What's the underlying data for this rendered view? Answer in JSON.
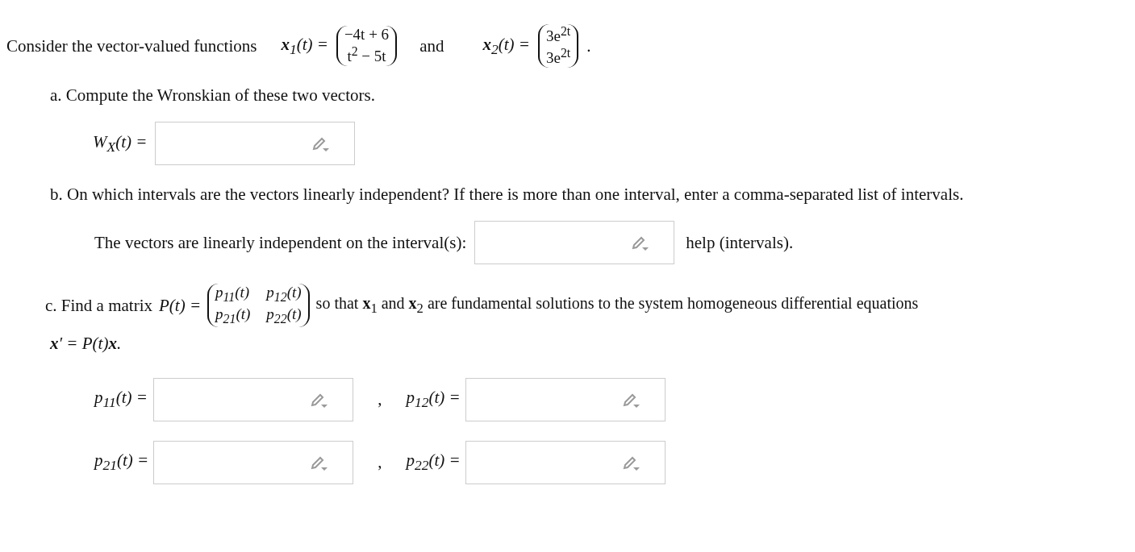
{
  "intro": {
    "text": "Consider the vector-valued functions",
    "connector": "and",
    "end": ".",
    "vectors": [
      {
        "label": "**x**$_{1}$(t) =",
        "entries": [
          "−4t + 6",
          "t$^{2}$ − 5t"
        ]
      },
      {
        "label": "**x**$_{2}$(t) =",
        "entries": [
          "3e$^{2t}$",
          "3e$^{2t}$"
        ]
      }
    ]
  },
  "part_a": {
    "prompt": "a. Compute the Wronskian of these two vectors.",
    "answer_label": "W$_{X}$(t) ="
  },
  "part_b": {
    "prompt": "b. On which intervals are the vectors linearly independent? If there is more than one interval, enter a comma-separated list of intervals.",
    "answer_label": "The vectors are linearly independent on the interval(s):",
    "help_link": "help (intervals)."
  },
  "part_c": {
    "prompt_start": "c. Find a matrix",
    "matrix_label": "P(t) =",
    "matrix": [
      [
        "p$_{11}$(t)",
        "p$_{12}$(t)"
      ],
      [
        "p$_{21}$(t)",
        "p$_{22}$(t)"
      ]
    ],
    "prompt_end": "so that **x**$_{1}$ and **x**$_{2}$ are fundamental solutions to the system homogeneous differential equations",
    "equation": "**x**′ = P(t)**x**.",
    "answer_rows": [
      {
        "labels": [
          "p$_{11}$(t) =",
          "p$_{12}$(t) ="
        ],
        "separator": ","
      },
      {
        "labels": [
          "p$_{21}$(t) =",
          "p$_{22}$(t) ="
        ],
        "separator": ","
      }
    ]
  }
}
